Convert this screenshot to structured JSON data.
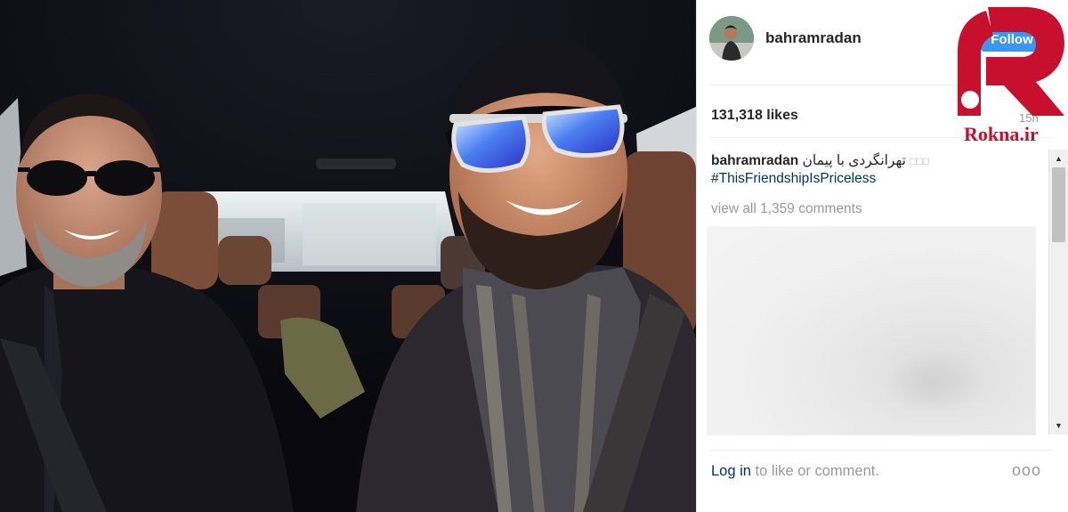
{
  "post": {
    "username": "bahramradan",
    "follow_label": "Follow",
    "likes": "131,318 likes",
    "time_ago": "15h",
    "caption_user": "bahramradan",
    "caption_emoji": "□□□",
    "caption_text": "تهرانگردی با پیمان",
    "hashtag": "#ThisFriendshipIsPriceless",
    "view_all_comments": "view all 1,359 comments",
    "login_link": "Log in",
    "login_suffix": " to like or comment.",
    "more_options": "ooo"
  },
  "watermark": {
    "text": "Rokna.ir",
    "color": "#c8102e"
  },
  "colors": {
    "follow_button": "#3897f0",
    "link": "#003569",
    "muted": "#999999",
    "text": "#262626"
  },
  "icons": {
    "avatar": "profile-avatar",
    "scroll_up": "triangle-up-icon",
    "scroll_down": "triangle-down-icon",
    "more": "more-options-icon"
  }
}
